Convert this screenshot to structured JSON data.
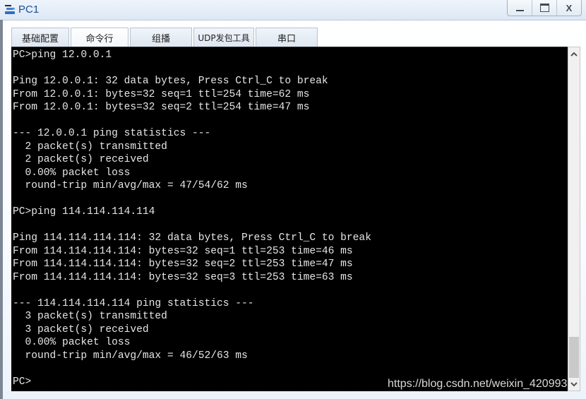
{
  "window": {
    "title": "PC1",
    "icon": "network-pc-icon",
    "controls": {
      "minimize": "minimize-icon",
      "maximize": "maximize-icon",
      "close_label": "X"
    }
  },
  "tabs": [
    {
      "label": "基础配置",
      "active": false
    },
    {
      "label": "命令行",
      "active": true
    },
    {
      "label": "组播",
      "active": false
    },
    {
      "label": "UDP发包工具",
      "active": false
    },
    {
      "label": "串口",
      "active": false
    }
  ],
  "terminal": {
    "lines": [
      "PC>ping 12.0.0.1",
      "",
      "Ping 12.0.0.1: 32 data bytes, Press Ctrl_C to break",
      "From 12.0.0.1: bytes=32 seq=1 ttl=254 time=62 ms",
      "From 12.0.0.1: bytes=32 seq=2 ttl=254 time=47 ms",
      "",
      "--- 12.0.0.1 ping statistics ---",
      "  2 packet(s) transmitted",
      "  2 packet(s) received",
      "  0.00% packet loss",
      "  round-trip min/avg/max = 47/54/62 ms",
      "",
      "PC>ping 114.114.114.114",
      "",
      "Ping 114.114.114.114: 32 data bytes, Press Ctrl_C to break",
      "From 114.114.114.114: bytes=32 seq=1 ttl=253 time=46 ms",
      "From 114.114.114.114: bytes=32 seq=2 ttl=253 time=47 ms",
      "From 114.114.114.114: bytes=32 seq=3 ttl=253 time=63 ms",
      "",
      "--- 114.114.114.114 ping statistics ---",
      "  3 packet(s) transmitted",
      "  3 packet(s) received",
      "  0.00% packet loss",
      "  round-trip min/avg/max = 46/52/63 ms",
      "",
      "PC>"
    ]
  },
  "scrollbar": {
    "up_icon": "chevron-up-icon",
    "down_icon": "chevron-down-icon",
    "position_fraction": 1.0
  },
  "watermark": "https://blog.csdn.net/weixin_420993"
}
